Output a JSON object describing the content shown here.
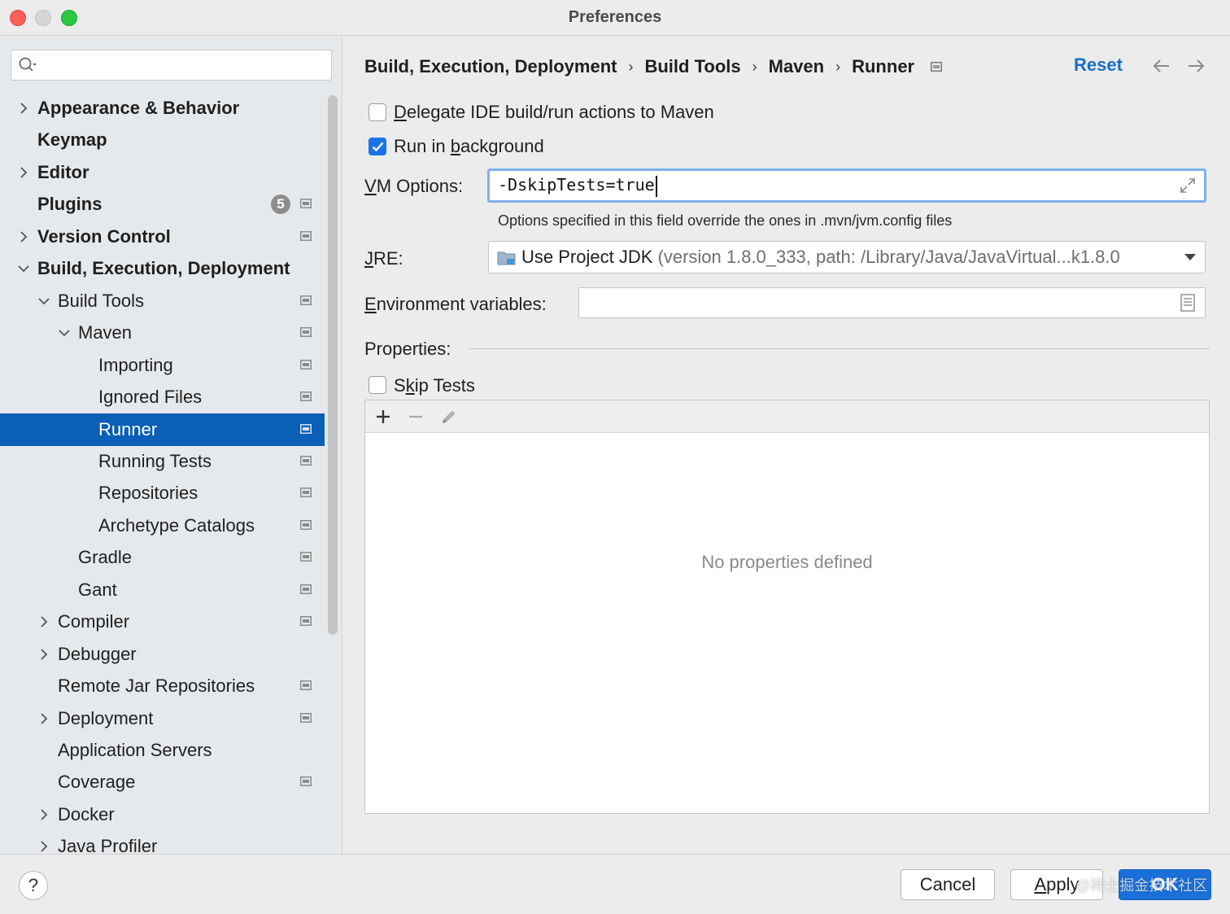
{
  "window": {
    "title": "Preferences"
  },
  "search": {
    "placeholder": ""
  },
  "sidebar": {
    "items": [
      {
        "label": "Appearance & Behavior",
        "indent": 0,
        "chevron": "right",
        "bold": true,
        "settings_icon": false
      },
      {
        "label": "Keymap",
        "indent": 0,
        "chevron": "none",
        "bold": true,
        "settings_icon": false
      },
      {
        "label": "Editor",
        "indent": 0,
        "chevron": "right",
        "bold": true,
        "settings_icon": false
      },
      {
        "label": "Plugins",
        "indent": 0,
        "chevron": "none",
        "bold": true,
        "settings_icon": true,
        "badge": "5"
      },
      {
        "label": "Version Control",
        "indent": 0,
        "chevron": "right",
        "bold": true,
        "settings_icon": true
      },
      {
        "label": "Build, Execution, Deployment",
        "indent": 0,
        "chevron": "down",
        "bold": true,
        "settings_icon": false
      },
      {
        "label": "Build Tools",
        "indent": 1,
        "chevron": "down",
        "bold": false,
        "settings_icon": true
      },
      {
        "label": "Maven",
        "indent": 2,
        "chevron": "down",
        "bold": false,
        "settings_icon": true
      },
      {
        "label": "Importing",
        "indent": 3,
        "chevron": "none",
        "bold": false,
        "settings_icon": true
      },
      {
        "label": "Ignored Files",
        "indent": 3,
        "chevron": "none",
        "bold": false,
        "settings_icon": true
      },
      {
        "label": "Runner",
        "indent": 3,
        "chevron": "none",
        "bold": false,
        "settings_icon": true,
        "selected": true
      },
      {
        "label": "Running Tests",
        "indent": 3,
        "chevron": "none",
        "bold": false,
        "settings_icon": true
      },
      {
        "label": "Repositories",
        "indent": 3,
        "chevron": "none",
        "bold": false,
        "settings_icon": true
      },
      {
        "label": "Archetype Catalogs",
        "indent": 3,
        "chevron": "none",
        "bold": false,
        "settings_icon": true
      },
      {
        "label": "Gradle",
        "indent": 2,
        "chevron": "none",
        "bold": false,
        "settings_icon": true
      },
      {
        "label": "Gant",
        "indent": 2,
        "chevron": "none",
        "bold": false,
        "settings_icon": true
      },
      {
        "label": "Compiler",
        "indent": 1,
        "chevron": "right",
        "bold": false,
        "settings_icon": true
      },
      {
        "label": "Debugger",
        "indent": 1,
        "chevron": "right",
        "bold": false,
        "settings_icon": false
      },
      {
        "label": "Remote Jar Repositories",
        "indent": 1,
        "chevron": "none",
        "bold": false,
        "settings_icon": true
      },
      {
        "label": "Deployment",
        "indent": 1,
        "chevron": "right",
        "bold": false,
        "settings_icon": true
      },
      {
        "label": "Application Servers",
        "indent": 1,
        "chevron": "none",
        "bold": false,
        "settings_icon": false
      },
      {
        "label": "Coverage",
        "indent": 1,
        "chevron": "none",
        "bold": false,
        "settings_icon": true
      },
      {
        "label": "Docker",
        "indent": 1,
        "chevron": "right",
        "bold": false,
        "settings_icon": false
      },
      {
        "label": "Java Profiler",
        "indent": 1,
        "chevron": "right",
        "bold": false,
        "settings_icon": false
      }
    ]
  },
  "breadcrumb": {
    "items": [
      "Build, Execution, Deployment",
      "Build Tools",
      "Maven",
      "Runner"
    ],
    "separator": "›"
  },
  "header": {
    "reset_label": "Reset"
  },
  "form": {
    "delegate": {
      "label_pre": "",
      "mnemonic": "D",
      "label_post": "elegate IDE build/run actions to Maven",
      "checked": false
    },
    "background": {
      "label_pre": "Run in ",
      "mnemonic": "b",
      "label_post": "ackground",
      "checked": true
    },
    "vm_options": {
      "label_pre": "",
      "mnemonic": "V",
      "label_post": "M Options:",
      "value": "-DskipTests=true"
    },
    "hint": "Options specified in this field override the ones in .mvn/jvm.config files",
    "jre": {
      "label_pre": "",
      "mnemonic": "J",
      "label_post": "RE:",
      "value_main": "Use Project JDK",
      "value_detail": " (version 1.8.0_333, path: /Library/Java/JavaVirtual...k1.8.0"
    },
    "env": {
      "label_pre": "",
      "mnemonic": "E",
      "label_post": "nvironment variables:",
      "value": ""
    },
    "properties_label": "Properties:",
    "skip_tests": {
      "label_pre": "S",
      "mnemonic": "k",
      "label_post": "ip Tests",
      "checked": false
    },
    "empty_text": "No properties defined"
  },
  "footer": {
    "help": "?",
    "cancel": "Cancel",
    "apply_pre": "",
    "apply_mnemonic": "A",
    "apply_post": "pply",
    "ok": "OK",
    "watermark": "@稀土掘金技术社区"
  },
  "colors": {
    "accent": "#1a6dc9",
    "selection": "#0b5fb6",
    "checkbox_checked": "#1a73e8",
    "ok_button": "#1a6fd8"
  },
  "icons": {
    "search": "search-icon",
    "project_settings": "project-settings-icon",
    "back": "arrow-left-icon",
    "forward": "arrow-right-icon",
    "expand": "expand-icon",
    "jre_folder": "jdk-folder-icon",
    "dropdown": "chevron-down-icon",
    "env_edit": "document-icon",
    "add": "plus-icon",
    "remove": "minus-icon",
    "edit": "pencil-icon"
  }
}
